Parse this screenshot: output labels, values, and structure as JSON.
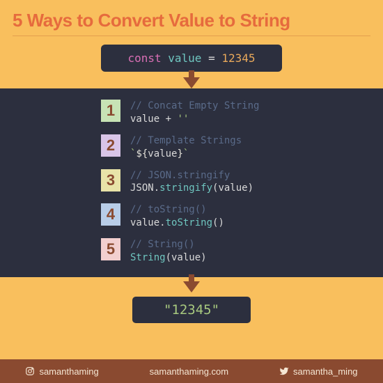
{
  "title": "5 Ways to Convert Value to String",
  "declaration": {
    "const": "const",
    "name": "value",
    "eq": "=",
    "num": "12345"
  },
  "methods": [
    {
      "n": "1",
      "comment": "// Concat Empty String",
      "tokens": [
        [
          "plain",
          "value "
        ],
        [
          "plain",
          "+ "
        ],
        [
          "string",
          "''"
        ]
      ]
    },
    {
      "n": "2",
      "comment": "// Template Strings",
      "tokens": [
        [
          "string",
          "`"
        ],
        [
          "interp",
          "${"
        ],
        [
          "plain",
          "value"
        ],
        [
          "interp",
          "}"
        ],
        [
          "string",
          "`"
        ]
      ]
    },
    {
      "n": "3",
      "comment": "// JSON.stringify",
      "tokens": [
        [
          "plain",
          "JSON"
        ],
        [
          "plain",
          "."
        ],
        [
          "method",
          "stringify"
        ],
        [
          "plain",
          "(value)"
        ]
      ]
    },
    {
      "n": "4",
      "comment": "// toString()",
      "tokens": [
        [
          "plain",
          "value"
        ],
        [
          "plain",
          "."
        ],
        [
          "method",
          "toString"
        ],
        [
          "plain",
          "()"
        ]
      ]
    },
    {
      "n": "5",
      "comment": "// String()",
      "tokens": [
        [
          "method",
          "String"
        ],
        [
          "plain",
          "(value)"
        ]
      ]
    }
  ],
  "result": "\"12345\"",
  "footer": {
    "instagram": "samanthaming",
    "site": "samanthaming.com",
    "twitter": "samantha_ming"
  }
}
